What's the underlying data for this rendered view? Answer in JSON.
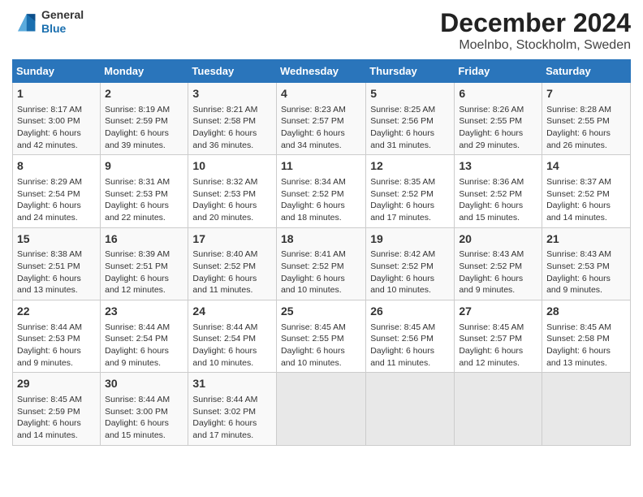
{
  "header": {
    "logo_line1": "General",
    "logo_line2": "Blue",
    "month": "December 2024",
    "location": "Moelnbo, Stockholm, Sweden"
  },
  "weekdays": [
    "Sunday",
    "Monday",
    "Tuesday",
    "Wednesday",
    "Thursday",
    "Friday",
    "Saturday"
  ],
  "weeks": [
    [
      {
        "day": "1",
        "content": "Sunrise: 8:17 AM\nSunset: 3:00 PM\nDaylight: 6 hours\nand 42 minutes."
      },
      {
        "day": "2",
        "content": "Sunrise: 8:19 AM\nSunset: 2:59 PM\nDaylight: 6 hours\nand 39 minutes."
      },
      {
        "day": "3",
        "content": "Sunrise: 8:21 AM\nSunset: 2:58 PM\nDaylight: 6 hours\nand 36 minutes."
      },
      {
        "day": "4",
        "content": "Sunrise: 8:23 AM\nSunset: 2:57 PM\nDaylight: 6 hours\nand 34 minutes."
      },
      {
        "day": "5",
        "content": "Sunrise: 8:25 AM\nSunset: 2:56 PM\nDaylight: 6 hours\nand 31 minutes."
      },
      {
        "day": "6",
        "content": "Sunrise: 8:26 AM\nSunset: 2:55 PM\nDaylight: 6 hours\nand 29 minutes."
      },
      {
        "day": "7",
        "content": "Sunrise: 8:28 AM\nSunset: 2:55 PM\nDaylight: 6 hours\nand 26 minutes."
      }
    ],
    [
      {
        "day": "8",
        "content": "Sunrise: 8:29 AM\nSunset: 2:54 PM\nDaylight: 6 hours\nand 24 minutes."
      },
      {
        "day": "9",
        "content": "Sunrise: 8:31 AM\nSunset: 2:53 PM\nDaylight: 6 hours\nand 22 minutes."
      },
      {
        "day": "10",
        "content": "Sunrise: 8:32 AM\nSunset: 2:53 PM\nDaylight: 6 hours\nand 20 minutes."
      },
      {
        "day": "11",
        "content": "Sunrise: 8:34 AM\nSunset: 2:52 PM\nDaylight: 6 hours\nand 18 minutes."
      },
      {
        "day": "12",
        "content": "Sunrise: 8:35 AM\nSunset: 2:52 PM\nDaylight: 6 hours\nand 17 minutes."
      },
      {
        "day": "13",
        "content": "Sunrise: 8:36 AM\nSunset: 2:52 PM\nDaylight: 6 hours\nand 15 minutes."
      },
      {
        "day": "14",
        "content": "Sunrise: 8:37 AM\nSunset: 2:52 PM\nDaylight: 6 hours\nand 14 minutes."
      }
    ],
    [
      {
        "day": "15",
        "content": "Sunrise: 8:38 AM\nSunset: 2:51 PM\nDaylight: 6 hours\nand 13 minutes."
      },
      {
        "day": "16",
        "content": "Sunrise: 8:39 AM\nSunset: 2:51 PM\nDaylight: 6 hours\nand 12 minutes."
      },
      {
        "day": "17",
        "content": "Sunrise: 8:40 AM\nSunset: 2:52 PM\nDaylight: 6 hours\nand 11 minutes."
      },
      {
        "day": "18",
        "content": "Sunrise: 8:41 AM\nSunset: 2:52 PM\nDaylight: 6 hours\nand 10 minutes."
      },
      {
        "day": "19",
        "content": "Sunrise: 8:42 AM\nSunset: 2:52 PM\nDaylight: 6 hours\nand 10 minutes."
      },
      {
        "day": "20",
        "content": "Sunrise: 8:43 AM\nSunset: 2:52 PM\nDaylight: 6 hours\nand 9 minutes."
      },
      {
        "day": "21",
        "content": "Sunrise: 8:43 AM\nSunset: 2:53 PM\nDaylight: 6 hours\nand 9 minutes."
      }
    ],
    [
      {
        "day": "22",
        "content": "Sunrise: 8:44 AM\nSunset: 2:53 PM\nDaylight: 6 hours\nand 9 minutes."
      },
      {
        "day": "23",
        "content": "Sunrise: 8:44 AM\nSunset: 2:54 PM\nDaylight: 6 hours\nand 9 minutes."
      },
      {
        "day": "24",
        "content": "Sunrise: 8:44 AM\nSunset: 2:54 PM\nDaylight: 6 hours\nand 10 minutes."
      },
      {
        "day": "25",
        "content": "Sunrise: 8:45 AM\nSunset: 2:55 PM\nDaylight: 6 hours\nand 10 minutes."
      },
      {
        "day": "26",
        "content": "Sunrise: 8:45 AM\nSunset: 2:56 PM\nDaylight: 6 hours\nand 11 minutes."
      },
      {
        "day": "27",
        "content": "Sunrise: 8:45 AM\nSunset: 2:57 PM\nDaylight: 6 hours\nand 12 minutes."
      },
      {
        "day": "28",
        "content": "Sunrise: 8:45 AM\nSunset: 2:58 PM\nDaylight: 6 hours\nand 13 minutes."
      }
    ],
    [
      {
        "day": "29",
        "content": "Sunrise: 8:45 AM\nSunset: 2:59 PM\nDaylight: 6 hours\nand 14 minutes."
      },
      {
        "day": "30",
        "content": "Sunrise: 8:44 AM\nSunset: 3:00 PM\nDaylight: 6 hours\nand 15 minutes."
      },
      {
        "day": "31",
        "content": "Sunrise: 8:44 AM\nSunset: 3:02 PM\nDaylight: 6 hours\nand 17 minutes."
      },
      {
        "day": "",
        "content": ""
      },
      {
        "day": "",
        "content": ""
      },
      {
        "day": "",
        "content": ""
      },
      {
        "day": "",
        "content": ""
      }
    ]
  ]
}
